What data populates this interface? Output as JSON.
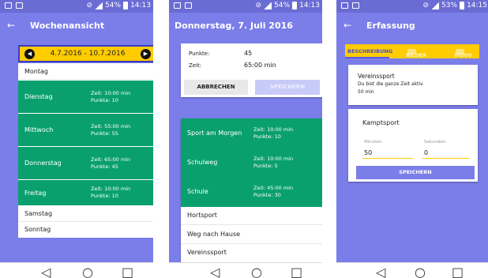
{
  "status": [
    {
      "time": "14:13",
      "battery": "54%"
    },
    {
      "time": "14:13",
      "battery": "54%"
    },
    {
      "time": "14:15",
      "battery": "53%"
    }
  ],
  "screen1": {
    "title": "Wochenansicht",
    "week_range": "4.7.2016 - 10.7.2016",
    "days": [
      {
        "name": "Montag",
        "time": "",
        "points": ""
      },
      {
        "name": "Dienstag",
        "time": "Zeit: 10:00 min",
        "points": "Punkte: 10"
      },
      {
        "name": "Mittwoch",
        "time": "Zeit: 55:00 min",
        "points": "Punkte: 55"
      },
      {
        "name": "Donnerstag",
        "time": "Zeit: 65:00 min",
        "points": "Punkte: 45"
      },
      {
        "name": "Freitag",
        "time": "Zeit: 10:00 min",
        "points": "Punkte: 10"
      },
      {
        "name": "Samstag",
        "time": "",
        "points": ""
      },
      {
        "name": "Sonntag",
        "time": "",
        "points": ""
      }
    ]
  },
  "screen2": {
    "title": "Donnerstag, 7. Juli 2016",
    "summary": {
      "points_label": "Punkte:",
      "points_value": "45",
      "time_label": "Zeit:",
      "time_value": "65:00 min"
    },
    "cancel_label": "ABBRECHEN",
    "save_label": "SPEICHERN",
    "items": [
      {
        "name": "Sport am Morgen",
        "time": "Zeit: 10:00 min",
        "points": "Punkte: 10"
      },
      {
        "name": "Schulweg",
        "time": "Zeit: 10:00 min",
        "points": "Punkte: 5"
      },
      {
        "name": "Schule",
        "time": "Zeit: 45:00 min",
        "points": "Punkte: 30"
      },
      {
        "name": "Hortsport",
        "time": "",
        "points": ""
      },
      {
        "name": "Weg nach Hause",
        "time": "",
        "points": ""
      },
      {
        "name": "Vereinssport",
        "time": "",
        "points": ""
      }
    ]
  },
  "screen3": {
    "title": "Erfassung",
    "tabs": [
      "BESCHREIBUNG",
      "BILDER",
      "VIDEO"
    ],
    "desc": {
      "title": "Vereinssport",
      "line1": "Du bist die ganze Zeit aktiv",
      "line2": "50 min"
    },
    "form": {
      "title": "Kamptsport",
      "minutes_label": "Minuten",
      "minutes_value": "50",
      "seconds_label": "Sekunden",
      "seconds_value": "0",
      "save_label": "SPEICHERN"
    }
  }
}
